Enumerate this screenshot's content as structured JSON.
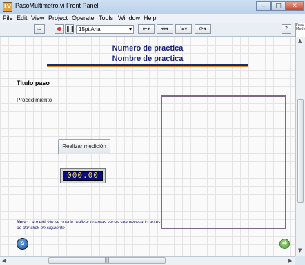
{
  "window": {
    "title": "PasoMultimetro.vi Front Panel",
    "icon_label": "LV",
    "controls": {
      "minimize": "–",
      "maximize": "□",
      "close": "✕"
    }
  },
  "menu": {
    "items": [
      "File",
      "Edit",
      "View",
      "Project",
      "Operate",
      "Tools",
      "Window",
      "Help"
    ]
  },
  "toolbar": {
    "run_icon": "⇨",
    "stop_icon": "●",
    "pause_icon": "❚❚",
    "font": "15pt Arial",
    "font_dropdown_icon": "▾",
    "align_icon": "⇤▾",
    "distribute_icon": "⇹▾",
    "resize_icon": "⇲▾",
    "reorder_icon": "⟳▾",
    "help_icon": "?",
    "help_box_text": "Paso Medic"
  },
  "panel": {
    "practice_number": "Numero de practica",
    "practice_name": "Nombre de practica",
    "step_title": "Titulo paso",
    "procedure": "Procedimiento",
    "measure_button": "Realizar medición",
    "numeric_value": "000.00",
    "note_bold": "Nota:",
    "note_text": " La medición se puede realizar cuantas veces sea necesario antes de dar click en siguiente",
    "home_icon": "⌂",
    "next_icon": "➜"
  },
  "scroll": {
    "up_arrow": "▲",
    "down_arrow": "▼",
    "left_arrow": "◀",
    "right_arrow": "▶",
    "grip": "|||"
  },
  "colors": {
    "heading": "#1a1f7a",
    "rule_navy": "#1c2a6b",
    "rule_orange": "#d98c1a",
    "numeric_bg": "#0a0a7a",
    "numeric_text": "#f3d64a",
    "graph_frame": "#7a6a85"
  }
}
